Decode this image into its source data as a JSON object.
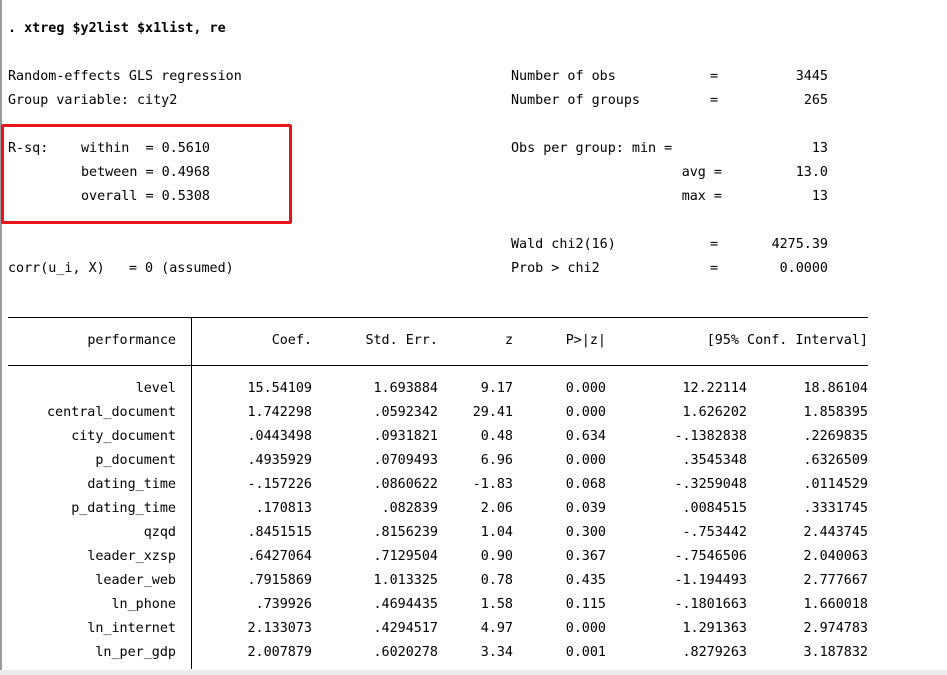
{
  "command": ". xtreg $y2list $x1list, re",
  "header": {
    "model": "Random-effects GLS regression",
    "group_variable": "Group variable: city2",
    "rsq_label": "R-sq:",
    "rsq_within": "within  = 0.5610",
    "rsq_between": "between = 0.4968",
    "rsq_overall": "overall = 0.5308",
    "corr": "corr(u_i, X)   = 0 (assumed)",
    "right": {
      "nobs_label": "Number of obs",
      "nobs_eq": "=",
      "nobs_value": "3445",
      "ngroups_label": "Number of groups",
      "ngroups_eq": "=",
      "ngroups_value": "265",
      "obs_per_group_label": "Obs per group: min =",
      "obs_min_value": "13",
      "obs_avg_label": "avg =",
      "obs_avg_value": "13.0",
      "obs_max_label": "max =",
      "obs_max_value": "13",
      "wald_label": "Wald chi2(16)",
      "wald_eq": "=",
      "wald_value": "4275.39",
      "prob_label": "Prob > chi2",
      "prob_eq": "=",
      "prob_value": "0.0000"
    }
  },
  "table": {
    "dep_var": "performance",
    "columns": [
      "Coef.",
      "Std. Err.",
      "z",
      "P>|z|",
      "[95% Conf. Interval]"
    ],
    "rows": [
      {
        "var": "level",
        "coef": "15.54109",
        "se": "1.693884",
        "z": "9.17",
        "p": "0.000",
        "lo": "12.22114",
        "hi": "18.86104"
      },
      {
        "var": "central_document",
        "coef": "1.742298",
        "se": ".0592342",
        "z": "29.41",
        "p": "0.000",
        "lo": "1.626202",
        "hi": "1.858395"
      },
      {
        "var": "city_document",
        "coef": ".0443498",
        "se": ".0931821",
        "z": "0.48",
        "p": "0.634",
        "lo": "-.1382838",
        "hi": ".2269835"
      },
      {
        "var": "p_document",
        "coef": ".4935929",
        "se": ".0709493",
        "z": "6.96",
        "p": "0.000",
        "lo": ".3545348",
        "hi": ".6326509"
      },
      {
        "var": "dating_time",
        "coef": "-.157226",
        "se": ".0860622",
        "z": "-1.83",
        "p": "0.068",
        "lo": "-.3259048",
        "hi": ".0114529"
      },
      {
        "var": "p_dating_time",
        "coef": ".170813",
        "se": ".082839",
        "z": "2.06",
        "p": "0.039",
        "lo": ".0084515",
        "hi": ".3331745"
      },
      {
        "var": "qzqd",
        "coef": ".8451515",
        "se": ".8156239",
        "z": "1.04",
        "p": "0.300",
        "lo": "-.753442",
        "hi": "2.443745"
      },
      {
        "var": "leader_xzsp",
        "coef": ".6427064",
        "se": ".7129504",
        "z": "0.90",
        "p": "0.367",
        "lo": "-.7546506",
        "hi": "2.040063"
      },
      {
        "var": "leader_web",
        "coef": ".7915869",
        "se": "1.013325",
        "z": "0.78",
        "p": "0.435",
        "lo": "-1.194493",
        "hi": "2.777667"
      },
      {
        "var": "ln_phone",
        "coef": ".739926",
        "se": ".4694435",
        "z": "1.58",
        "p": "0.115",
        "lo": "-.1801663",
        "hi": "1.660018"
      },
      {
        "var": "ln_internet",
        "coef": "2.133073",
        "se": ".4294517",
        "z": "4.97",
        "p": "0.000",
        "lo": "1.291363",
        "hi": "2.974783"
      },
      {
        "var": "ln_per_gdp",
        "coef": "2.007879",
        "se": ".6020278",
        "z": "3.34",
        "p": "0.001",
        "lo": ".8279263",
        "hi": "3.187832"
      }
    ]
  },
  "highlight_color": "#e8141a"
}
